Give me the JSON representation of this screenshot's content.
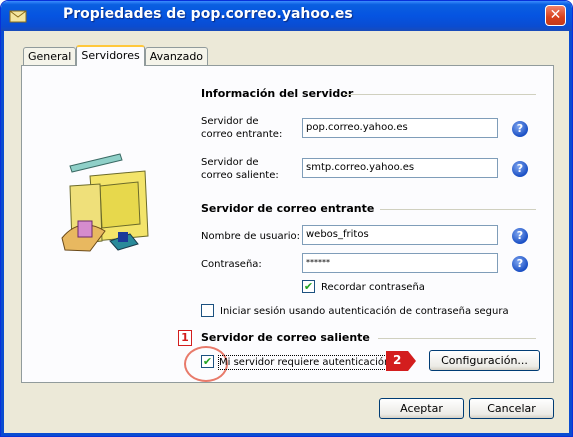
{
  "window": {
    "title": "Propiedades de pop.correo.yahoo.es",
    "close_symbol": "✕"
  },
  "tabs": [
    {
      "label": "General"
    },
    {
      "label": "Servidores"
    },
    {
      "label": "Avanzado"
    }
  ],
  "server_info": {
    "title": "Información del servidor",
    "incoming_label_1": "Servidor de",
    "incoming_label_2": "correo entrante:",
    "incoming_value": "pop.correo.yahoo.es",
    "outgoing_label_1": "Servidor de",
    "outgoing_label_2": "correo saliente:",
    "outgoing_value": "smtp.correo.yahoo.es"
  },
  "incoming_server": {
    "title": "Servidor de correo entrante",
    "username_label": "Nombre de usuario:",
    "username_value": "webos_fritos",
    "password_label": "Contraseña:",
    "password_value": "******",
    "remember_label": "Recordar contraseña",
    "remember_checked": true,
    "secure_auth_label": "Iniciar sesión usando autenticación de contraseña segura",
    "secure_auth_checked": false
  },
  "outgoing_server": {
    "title": "Servidor de correo saliente",
    "auth_label": "Mi servidor requiere autenticación",
    "auth_checked": true,
    "config_button": "Configuración..."
  },
  "annotations": {
    "marker_1": "1",
    "marker_2": "2",
    "marker_color": "#d31e1e"
  },
  "buttons": {
    "accept": "Aceptar",
    "cancel": "Cancelar"
  },
  "help_symbol": "?",
  "check_symbol": "✔",
  "icons": {
    "title": "mail-properties-icon",
    "illustration": "mail-server-computer-icon",
    "help": "help-icon"
  }
}
